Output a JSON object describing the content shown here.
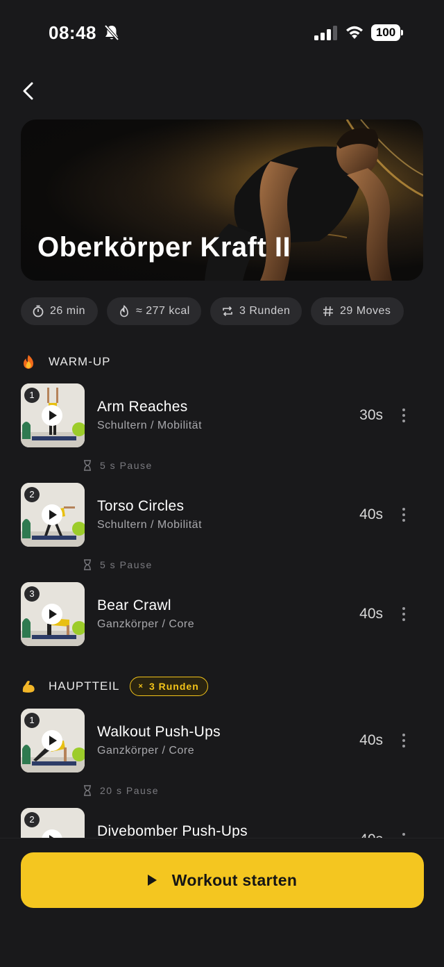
{
  "status_bar": {
    "time": "08:48",
    "battery": "100"
  },
  "workout": {
    "title": "Oberkörper Kraft II"
  },
  "stats": [
    {
      "icon": "stopwatch-icon",
      "label": "26 min"
    },
    {
      "icon": "flame-icon",
      "label": "≈ 277 kcal"
    },
    {
      "icon": "repeat-icon",
      "label": "3 Runden"
    },
    {
      "icon": "hash-icon",
      "label": "29 Moves"
    }
  ],
  "warmup": {
    "emoji": "fire-emoji",
    "label": "WARM-UP",
    "exercises": [
      {
        "num": "1",
        "name": "Arm Reaches",
        "sub": "Schultern / Mobilität",
        "duration": "30s",
        "pause": "5 s Pause"
      },
      {
        "num": "2",
        "name": "Torso Circles",
        "sub": "Schultern / Mobilität",
        "duration": "40s",
        "pause": "5 s Pause"
      },
      {
        "num": "3",
        "name": "Bear Crawl",
        "sub": "Ganzkörper / Core",
        "duration": "40s"
      }
    ]
  },
  "main": {
    "emoji": "flexed-biceps-emoji",
    "label": "HAUPTTEIL",
    "rounds_badge": "3 Runden",
    "rounds_prefix": "×",
    "exercises": [
      {
        "num": "1",
        "name": "Walkout Push-Ups",
        "sub": "Ganzkörper / Core",
        "duration": "40s",
        "pause": "20 s Pause"
      },
      {
        "num": "2",
        "name": "Divebomber Push-Ups",
        "sub": "",
        "duration": "40s"
      }
    ]
  },
  "cta": {
    "label": "Workout starten"
  },
  "colors": {
    "accent": "#f4c620",
    "background": "#19191b",
    "chip": "#2a2a2d"
  }
}
